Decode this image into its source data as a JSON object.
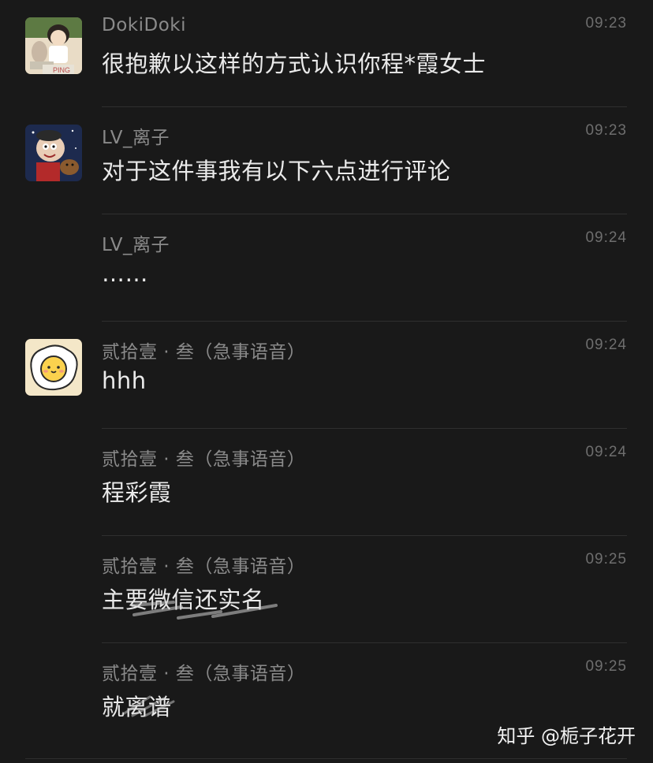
{
  "messages": [
    {
      "sender": "DokiDoki",
      "time": "09:23",
      "text": "很抱歉以这样的方式认识你程*霞女士",
      "avatar": "anime-girl-avatar",
      "avatar_badge": "PING"
    },
    {
      "sender": "LV_离子",
      "time": "09:23",
      "text": "对于这件事我有以下六点进行评论",
      "avatar": "cartoon-character-avatar"
    },
    {
      "sender": "LV_离子",
      "time": "09:24",
      "text": "……"
    },
    {
      "sender": "贰拾壹 · 叁（急事语音）",
      "time": "09:24",
      "text": "hhh",
      "avatar": "fried-egg-avatar"
    },
    {
      "sender": "贰拾壹 · 叁（急事语音）",
      "time": "09:24",
      "text": "程彩霞"
    },
    {
      "sender": "贰拾壹 · 叁（急事语音）",
      "time": "09:25",
      "text": "主要微信还实名"
    },
    {
      "sender": "贰拾壹 · 叁（急事语音）",
      "time": "09:25",
      "text": "就离谱"
    }
  ],
  "watermark": "知乎 @栀子花开",
  "colors": {
    "background": "#191919",
    "sender_text": "#8a8a8a",
    "time_text": "#6e6e6e",
    "message_text": "#eaeaea",
    "divider": "#2f2f2f",
    "egg_avatar_bg": "#f4e7c8",
    "egg_yolk": "#fbd24e"
  }
}
